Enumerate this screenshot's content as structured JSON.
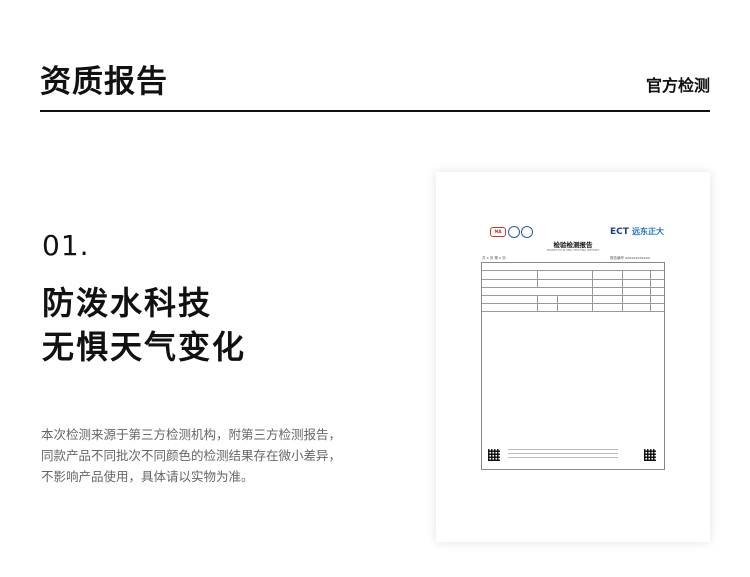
{
  "header": {
    "title": "资质报告",
    "tag": "官方检测"
  },
  "section": {
    "number": "01.",
    "headline_lines": [
      "防泼水科技",
      "无惧天气变化"
    ],
    "description_lines": [
      "本次检测来源于第三方检测机构，附第三方检测报告，",
      "同款产品不同批次不同颜色的检测结果存在微小差异，",
      "不影响产品使用，具体请以实物为准。"
    ]
  },
  "report": {
    "logos": {
      "cma": "MA",
      "brand": "ECT",
      "brand_cn": "远东正大"
    },
    "title": "检验检测报告",
    "subtitle": "INSPECTION AND TESTING REPORT",
    "meta_left": "共 x 页 第 x 页",
    "meta_right": "报告编号 xxxxxxxxxxxx"
  }
}
